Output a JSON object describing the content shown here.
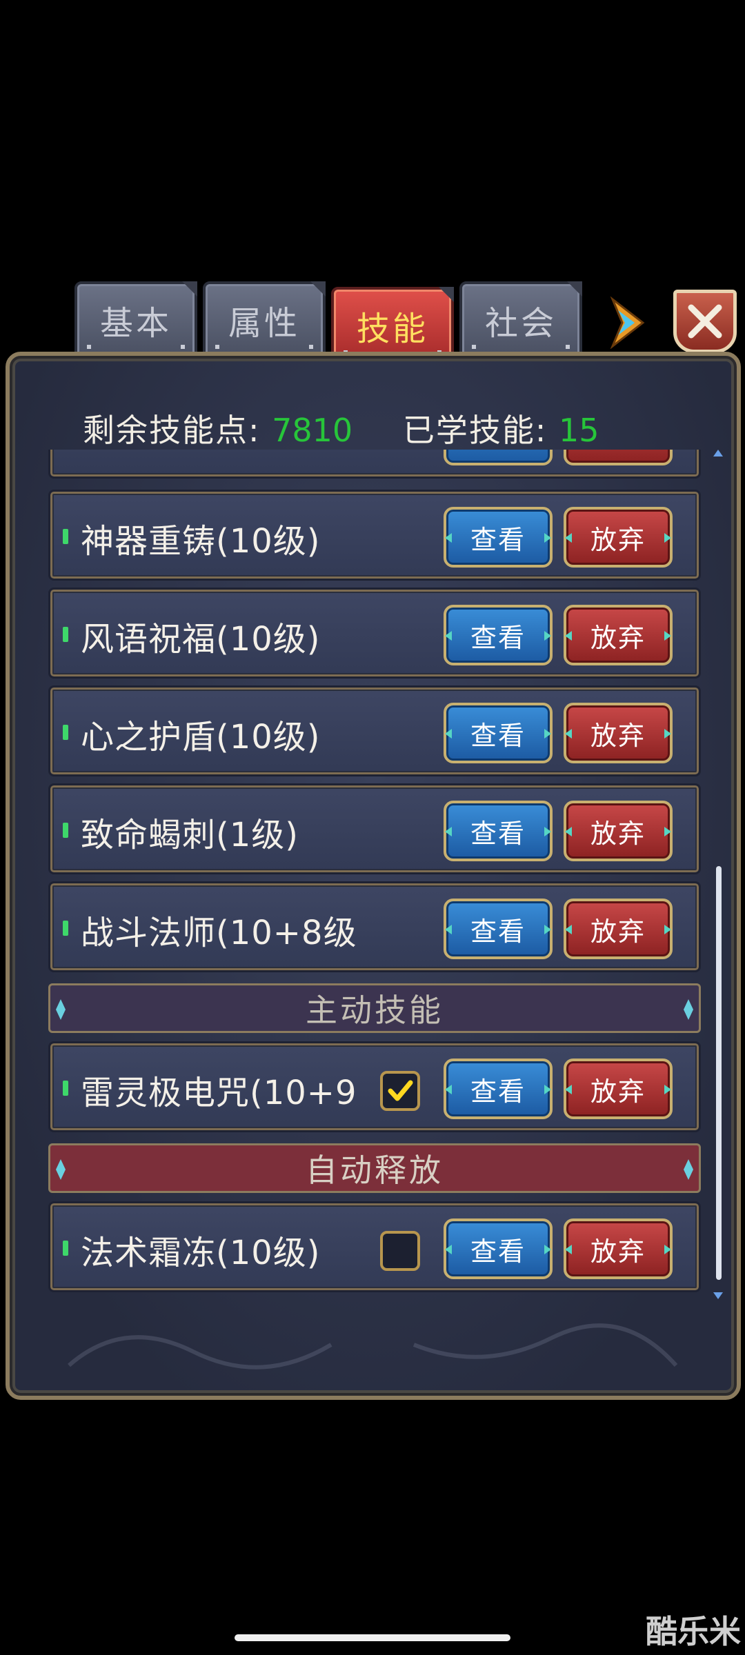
{
  "tabs": [
    {
      "label": "基本",
      "active": false
    },
    {
      "label": "属性",
      "active": false
    },
    {
      "label": "技能",
      "active": true
    },
    {
      "label": "社会",
      "active": false
    }
  ],
  "header": {
    "points_label": "剩余技能点:",
    "points_value": "7810",
    "learned_label": "已学技能:",
    "learned_value": "15"
  },
  "buttons": {
    "view": "查看",
    "drop": "放弃"
  },
  "skills": [
    {
      "name": "神器重铸(10级)"
    },
    {
      "name": "风语祝福(10级)"
    },
    {
      "name": "心之护盾(10级)"
    },
    {
      "name": "致命蝎刺(1级)"
    },
    {
      "name": "战斗法师(10+8级"
    }
  ],
  "sections": {
    "active_skills": "主动技能",
    "auto_cast": "自动释放"
  },
  "active_skills": [
    {
      "name": "雷灵极电咒(10+9",
      "checked": true
    }
  ],
  "auto_skills": [
    {
      "name": "法术霜冻(10级)",
      "checked": false
    }
  ],
  "watermark": "酷乐米",
  "colors": {
    "count_green": "#27c53a",
    "active_tab": "#d04040",
    "view_button": "#2a74c0",
    "drop_button": "#a83030"
  }
}
